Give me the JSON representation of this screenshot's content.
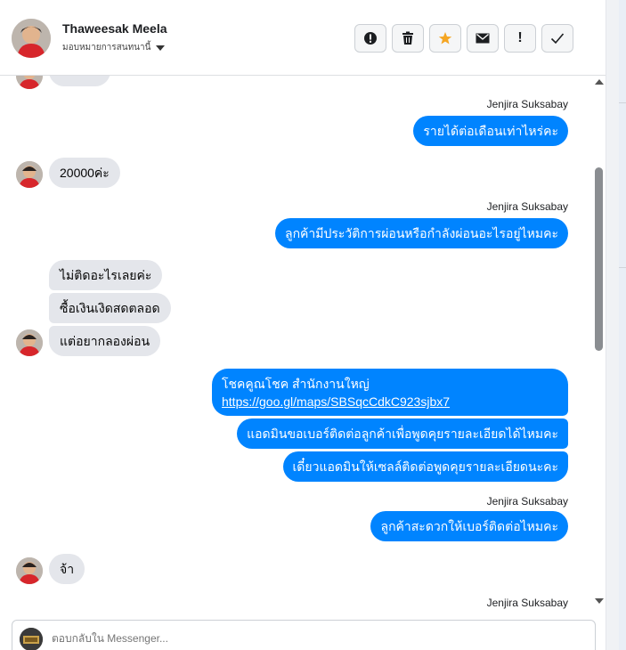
{
  "header": {
    "contact_name": "Thaweesak Meela",
    "assign_label": "มอบหมายการสนทนานี้"
  },
  "actions": [
    {
      "name": "report-spam-button",
      "icon": "alert-circle-icon"
    },
    {
      "name": "delete-button",
      "icon": "trash-icon"
    },
    {
      "name": "star-button",
      "icon": "star-icon",
      "color": "#f5a623"
    },
    {
      "name": "mark-unread-button",
      "icon": "envelope-icon"
    },
    {
      "name": "follow-up-button",
      "icon": "exclamation-icon",
      "label": "!"
    },
    {
      "name": "mark-done-button",
      "icon": "check-icon"
    }
  ],
  "thread": {
    "sender_name": "Jenjira Suksabay",
    "messages": {
      "out_income": "รายได้ต่อเดือนเท่าไหร่คะ",
      "in_20000": "20000ค่ะ",
      "out_history": "ลูกค้ามีประวัติการผ่อนหรือกำลังผ่อนอะไรอยู่ไหมคะ",
      "in_nothing": "ไม่ติดอะไรเลยค่ะ",
      "in_cash": "ซื้อเงินเงิดสดตลอด",
      "in_try": "แต่อยากลองผ่อน",
      "out_branch_title": "โชคคูณโชค สำนักงานใหญ่",
      "out_branch_link": "https://goo.gl/maps/SBSqcCdkC923sjbx7",
      "out_ask_phone": "แอดมินขอเบอร์ติดต่อลูกค้าเพื่อพูดคุยรายละเอียดได้ไหมคะ",
      "out_sales_contact": "เดี๋ยวแอดมินให้เซลล์ติดต่อพูดคุยรายละเอียดนะคะ",
      "out_convenient": "ลูกค้าสะดวกให้เบอร์ติดต่อไหมคะ",
      "in_yes": "จ้า"
    }
  },
  "composer": {
    "placeholder": "ตอบกลับใน Messenger..."
  },
  "colors": {
    "outgoing_bubble": "#0084ff",
    "incoming_bubble": "#e4e6eb",
    "star": "#f5a623"
  }
}
